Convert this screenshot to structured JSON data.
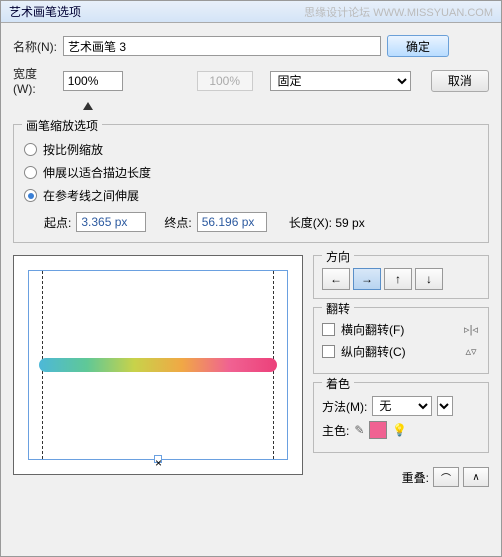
{
  "title": "艺术画笔选项",
  "watermark": "思缘设计论坛 WWW.MISSYUAN.COM",
  "buttons": {
    "ok": "确定",
    "cancel": "取消"
  },
  "name": {
    "label": "名称(N):",
    "value": "艺术画笔 3"
  },
  "width": {
    "label": "宽度(W):",
    "value": "100%",
    "fixed_btn": "100%",
    "dropdown": "固定"
  },
  "scale_group": {
    "legend": "画笔缩放选项",
    "opt1": "按比例缩放",
    "opt2": "伸展以适合描边长度",
    "opt3": "在参考线之间伸展",
    "start_label": "起点:",
    "start_value": "3.365 px",
    "end_label": "终点:",
    "end_value": "56.196 px",
    "length_label": "长度(X): 59 px"
  },
  "direction": {
    "legend": "方向"
  },
  "flip": {
    "legend": "翻转",
    "h": "横向翻转(F)",
    "v": "纵向翻转(C)"
  },
  "colorize": {
    "legend": "着色",
    "method_label": "方法(M):",
    "method_value": "无",
    "key_label": "主色:"
  },
  "overlap": {
    "label": "重叠:"
  }
}
